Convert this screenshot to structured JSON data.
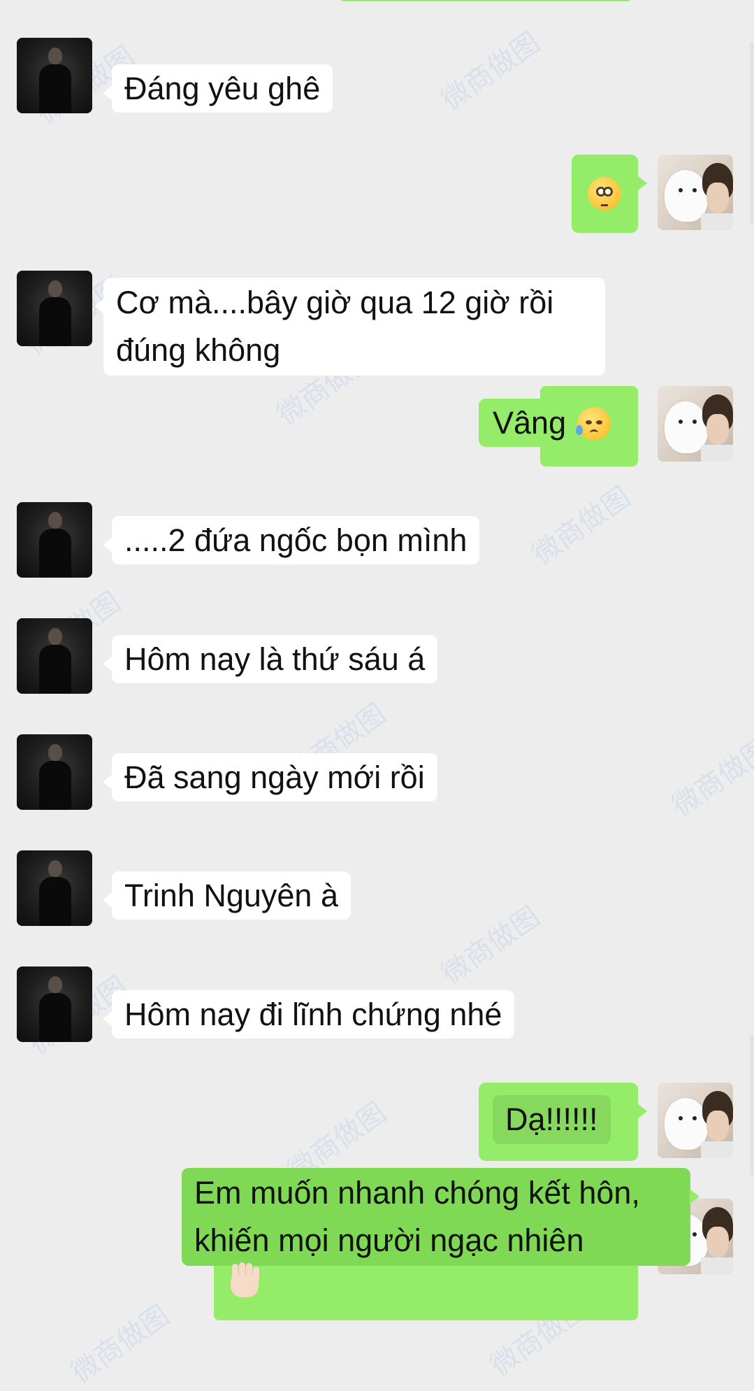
{
  "messages": [
    {
      "id": 1,
      "side": "in",
      "text": "Đáng yêu ghê"
    },
    {
      "id": 2,
      "side": "out",
      "emoji": "flushed-face"
    },
    {
      "id": 3,
      "side": "in",
      "line1": "Cơ mà....bây giờ qua 12 giờ rồi",
      "line2": "đúng không"
    },
    {
      "id": 4,
      "side": "out",
      "text": "Vâng",
      "emoji": "sad-sweat-face"
    },
    {
      "id": 5,
      "side": "in",
      "text": ".....2 đứa ngốc bọn mình"
    },
    {
      "id": 6,
      "side": "in",
      "text": "Hôm nay là thứ sáu á"
    },
    {
      "id": 7,
      "side": "in",
      "text": "Đã sang ngày mới rồi"
    },
    {
      "id": 8,
      "side": "in",
      "text": "Trinh Nguyên à"
    },
    {
      "id": 9,
      "side": "in",
      "text": "Hôm nay đi lĩnh chứng nhé"
    },
    {
      "id": 10,
      "side": "out",
      "text": "Dạ!!!!!!"
    },
    {
      "id": 11,
      "side": "out",
      "line1": "Em muốn nhanh chóng kết hôn,",
      "line2": "khiến mọi người ngạc nhiên",
      "emoji": "raised-hand"
    }
  ],
  "watermark": "微商做图",
  "colors": {
    "background": "#ededed",
    "incoming_bubble": "#ffffff",
    "outgoing_bubble": "#95ec69"
  },
  "avatars": {
    "contact": "man-in-black-suit-photo",
    "self": "white-dog-and-person-photo"
  }
}
